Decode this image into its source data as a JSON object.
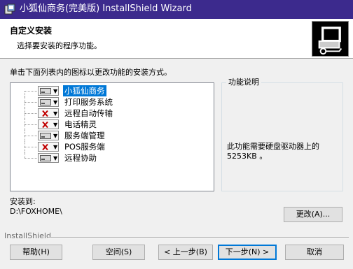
{
  "window": {
    "title": "小狐仙商务(完美版) InstallShield Wizard"
  },
  "header": {
    "title": "自定义安装",
    "subtitle": "选择要安装的程序功能。"
  },
  "instruction": "单击下面列表内的图标以更改功能的安装方式。",
  "tree": {
    "items": [
      {
        "label": "小狐仙商务",
        "state": "install",
        "selected": true
      },
      {
        "label": "打印服务系统",
        "state": "install",
        "selected": false
      },
      {
        "label": "远程自动传输",
        "state": "unavailable",
        "selected": false
      },
      {
        "label": "电话精灵",
        "state": "unavailable",
        "selected": false
      },
      {
        "label": "服务端管理",
        "state": "install",
        "selected": false
      },
      {
        "label": "POS服务端",
        "state": "unavailable",
        "selected": false
      },
      {
        "label": "远程协助",
        "state": "install",
        "selected": false
      }
    ]
  },
  "feature_description": {
    "legend": "功能说明",
    "text": "此功能需要硬盘驱动器上的 5253KB 。"
  },
  "install_to": {
    "label": "安装到:",
    "path": "D:\\FOXHOME\\"
  },
  "buttons": {
    "change": "更改(A)...",
    "help": "帮助(H)",
    "space": "空间(S)",
    "back": "< 上一步(B)",
    "next": "下一步(N) >",
    "cancel": "取消"
  },
  "footer": {
    "brand": "InstallShield"
  },
  "colors": {
    "titlebar": "#3c2a8d",
    "selection": "#0078d7",
    "unavailable_x": "#c00000"
  }
}
